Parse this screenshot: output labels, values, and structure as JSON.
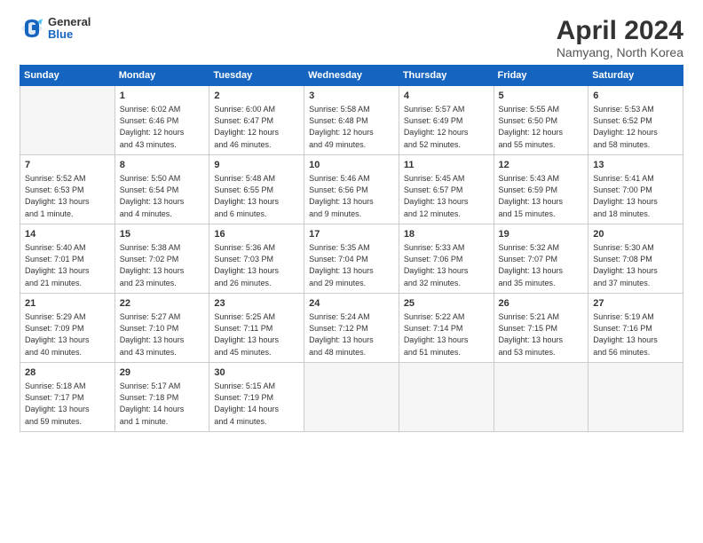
{
  "logo": {
    "general": "General",
    "blue": "Blue"
  },
  "title": "April 2024",
  "subtitle": "Namyang, North Korea",
  "headers": [
    "Sunday",
    "Monday",
    "Tuesday",
    "Wednesday",
    "Thursday",
    "Friday",
    "Saturday"
  ],
  "weeks": [
    [
      {
        "day": "",
        "info": ""
      },
      {
        "day": "1",
        "info": "Sunrise: 6:02 AM\nSunset: 6:46 PM\nDaylight: 12 hours\nand 43 minutes."
      },
      {
        "day": "2",
        "info": "Sunrise: 6:00 AM\nSunset: 6:47 PM\nDaylight: 12 hours\nand 46 minutes."
      },
      {
        "day": "3",
        "info": "Sunrise: 5:58 AM\nSunset: 6:48 PM\nDaylight: 12 hours\nand 49 minutes."
      },
      {
        "day": "4",
        "info": "Sunrise: 5:57 AM\nSunset: 6:49 PM\nDaylight: 12 hours\nand 52 minutes."
      },
      {
        "day": "5",
        "info": "Sunrise: 5:55 AM\nSunset: 6:50 PM\nDaylight: 12 hours\nand 55 minutes."
      },
      {
        "day": "6",
        "info": "Sunrise: 5:53 AM\nSunset: 6:52 PM\nDaylight: 12 hours\nand 58 minutes."
      }
    ],
    [
      {
        "day": "7",
        "info": "Sunrise: 5:52 AM\nSunset: 6:53 PM\nDaylight: 13 hours\nand 1 minute."
      },
      {
        "day": "8",
        "info": "Sunrise: 5:50 AM\nSunset: 6:54 PM\nDaylight: 13 hours\nand 4 minutes."
      },
      {
        "day": "9",
        "info": "Sunrise: 5:48 AM\nSunset: 6:55 PM\nDaylight: 13 hours\nand 6 minutes."
      },
      {
        "day": "10",
        "info": "Sunrise: 5:46 AM\nSunset: 6:56 PM\nDaylight: 13 hours\nand 9 minutes."
      },
      {
        "day": "11",
        "info": "Sunrise: 5:45 AM\nSunset: 6:57 PM\nDaylight: 13 hours\nand 12 minutes."
      },
      {
        "day": "12",
        "info": "Sunrise: 5:43 AM\nSunset: 6:59 PM\nDaylight: 13 hours\nand 15 minutes."
      },
      {
        "day": "13",
        "info": "Sunrise: 5:41 AM\nSunset: 7:00 PM\nDaylight: 13 hours\nand 18 minutes."
      }
    ],
    [
      {
        "day": "14",
        "info": "Sunrise: 5:40 AM\nSunset: 7:01 PM\nDaylight: 13 hours\nand 21 minutes."
      },
      {
        "day": "15",
        "info": "Sunrise: 5:38 AM\nSunset: 7:02 PM\nDaylight: 13 hours\nand 23 minutes."
      },
      {
        "day": "16",
        "info": "Sunrise: 5:36 AM\nSunset: 7:03 PM\nDaylight: 13 hours\nand 26 minutes."
      },
      {
        "day": "17",
        "info": "Sunrise: 5:35 AM\nSunset: 7:04 PM\nDaylight: 13 hours\nand 29 minutes."
      },
      {
        "day": "18",
        "info": "Sunrise: 5:33 AM\nSunset: 7:06 PM\nDaylight: 13 hours\nand 32 minutes."
      },
      {
        "day": "19",
        "info": "Sunrise: 5:32 AM\nSunset: 7:07 PM\nDaylight: 13 hours\nand 35 minutes."
      },
      {
        "day": "20",
        "info": "Sunrise: 5:30 AM\nSunset: 7:08 PM\nDaylight: 13 hours\nand 37 minutes."
      }
    ],
    [
      {
        "day": "21",
        "info": "Sunrise: 5:29 AM\nSunset: 7:09 PM\nDaylight: 13 hours\nand 40 minutes."
      },
      {
        "day": "22",
        "info": "Sunrise: 5:27 AM\nSunset: 7:10 PM\nDaylight: 13 hours\nand 43 minutes."
      },
      {
        "day": "23",
        "info": "Sunrise: 5:25 AM\nSunset: 7:11 PM\nDaylight: 13 hours\nand 45 minutes."
      },
      {
        "day": "24",
        "info": "Sunrise: 5:24 AM\nSunset: 7:12 PM\nDaylight: 13 hours\nand 48 minutes."
      },
      {
        "day": "25",
        "info": "Sunrise: 5:22 AM\nSunset: 7:14 PM\nDaylight: 13 hours\nand 51 minutes."
      },
      {
        "day": "26",
        "info": "Sunrise: 5:21 AM\nSunset: 7:15 PM\nDaylight: 13 hours\nand 53 minutes."
      },
      {
        "day": "27",
        "info": "Sunrise: 5:19 AM\nSunset: 7:16 PM\nDaylight: 13 hours\nand 56 minutes."
      }
    ],
    [
      {
        "day": "28",
        "info": "Sunrise: 5:18 AM\nSunset: 7:17 PM\nDaylight: 13 hours\nand 59 minutes."
      },
      {
        "day": "29",
        "info": "Sunrise: 5:17 AM\nSunset: 7:18 PM\nDaylight: 14 hours\nand 1 minute."
      },
      {
        "day": "30",
        "info": "Sunrise: 5:15 AM\nSunset: 7:19 PM\nDaylight: 14 hours\nand 4 minutes."
      },
      {
        "day": "",
        "info": ""
      },
      {
        "day": "",
        "info": ""
      },
      {
        "day": "",
        "info": ""
      },
      {
        "day": "",
        "info": ""
      }
    ]
  ]
}
